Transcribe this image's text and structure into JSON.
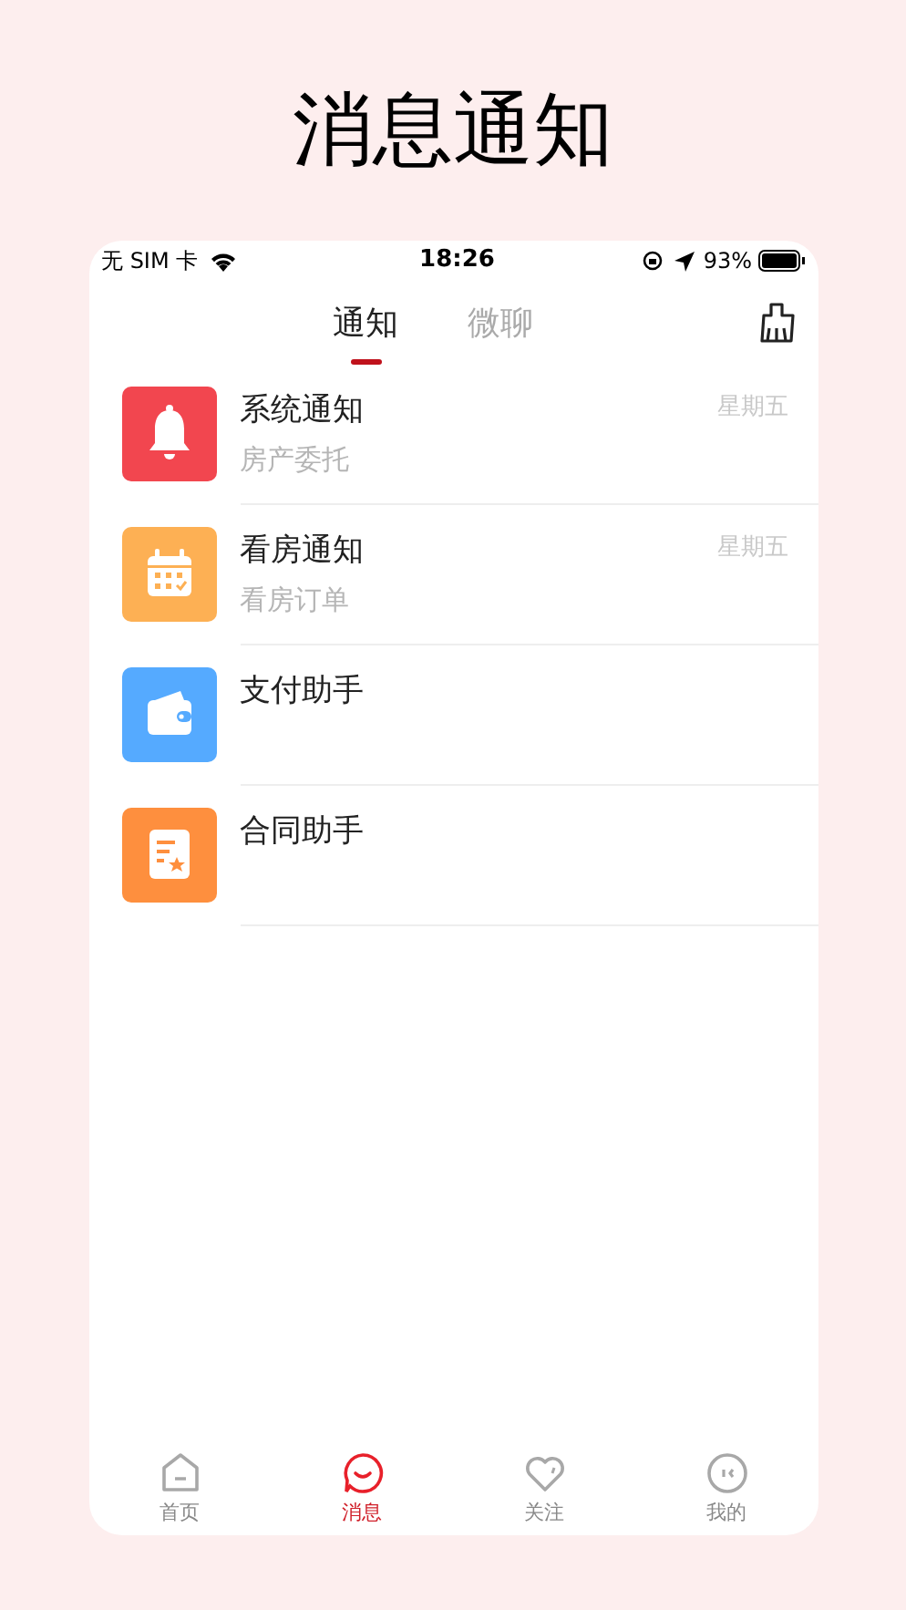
{
  "page_title": "消息通知",
  "status_bar": {
    "carrier": "无 SIM 卡",
    "time": "18:26",
    "battery": "93%"
  },
  "tabs": [
    {
      "label": "通知",
      "selected": true
    },
    {
      "label": "微聊",
      "selected": false
    }
  ],
  "messages": [
    {
      "kind": "bell",
      "color": "#f2464f",
      "title": "系统通知",
      "subtitle": "房产委托",
      "time": "星期五"
    },
    {
      "kind": "calendar",
      "color": "#fdb054",
      "title": "看房通知",
      "subtitle": "看房订单",
      "time": "星期五"
    },
    {
      "kind": "wallet",
      "color": "#55aaff",
      "title": "支付助手"
    },
    {
      "kind": "contract",
      "color": "#fe8f3e",
      "title": "合同助手"
    }
  ],
  "bottom_nav": [
    {
      "kind": "home",
      "label": "首页",
      "selected": false
    },
    {
      "kind": "chat",
      "label": "消息",
      "selected": true
    },
    {
      "kind": "heart",
      "label": "关注",
      "selected": false
    },
    {
      "kind": "face",
      "label": "我的",
      "selected": false
    }
  ]
}
